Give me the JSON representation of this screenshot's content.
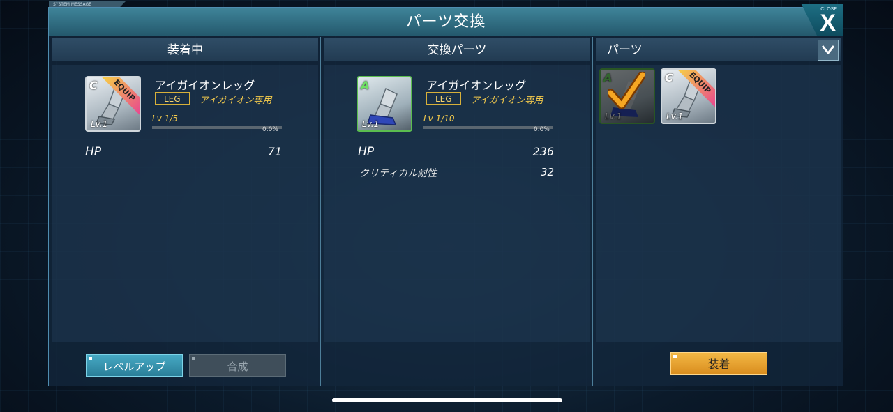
{
  "system_message": "SYSTEM MESSAGE",
  "title": "パーツ交換",
  "close": {
    "label": "CLOSE",
    "glyph": "X"
  },
  "equipped": {
    "header": "装着中",
    "card": {
      "rank": "C",
      "level": "Lv.1",
      "ribbon": "EQUIP"
    },
    "name": "アイガイオンレッグ",
    "slot_tag": "LEG",
    "exclusive": "アイガイオン専用",
    "level_text": "Lv 1/5",
    "progress_pct": "0.0%",
    "progress": 0,
    "stats": [
      {
        "label": "HP",
        "value": "71"
      }
    ]
  },
  "replacement": {
    "header": "交換パーツ",
    "card": {
      "rank": "A",
      "level": "Lv.1"
    },
    "name": "アイガイオンレッグ",
    "slot_tag": "LEG",
    "exclusive": "アイガイオン専用",
    "level_text": "Lv 1/10",
    "progress_pct": "0.0%",
    "progress": 0,
    "stats": [
      {
        "label": "HP",
        "value": "236"
      },
      {
        "label": "クリティカル耐性",
        "value": "32"
      }
    ]
  },
  "parts": {
    "header": "パーツ",
    "items": [
      {
        "rank": "A",
        "level": "Lv.1",
        "selected": true
      },
      {
        "rank": "C",
        "level": "Lv.1",
        "ribbon": "EQUIP"
      }
    ]
  },
  "buttons": {
    "level_up": "レベルアップ",
    "synthesize": "合成",
    "equip": "装着"
  },
  "colors": {
    "accent_gold": "#f2c94c",
    "title_teal": "#3f8499",
    "rank_a_green": "#5bbd4f",
    "equip_orange": "#e9a431"
  }
}
